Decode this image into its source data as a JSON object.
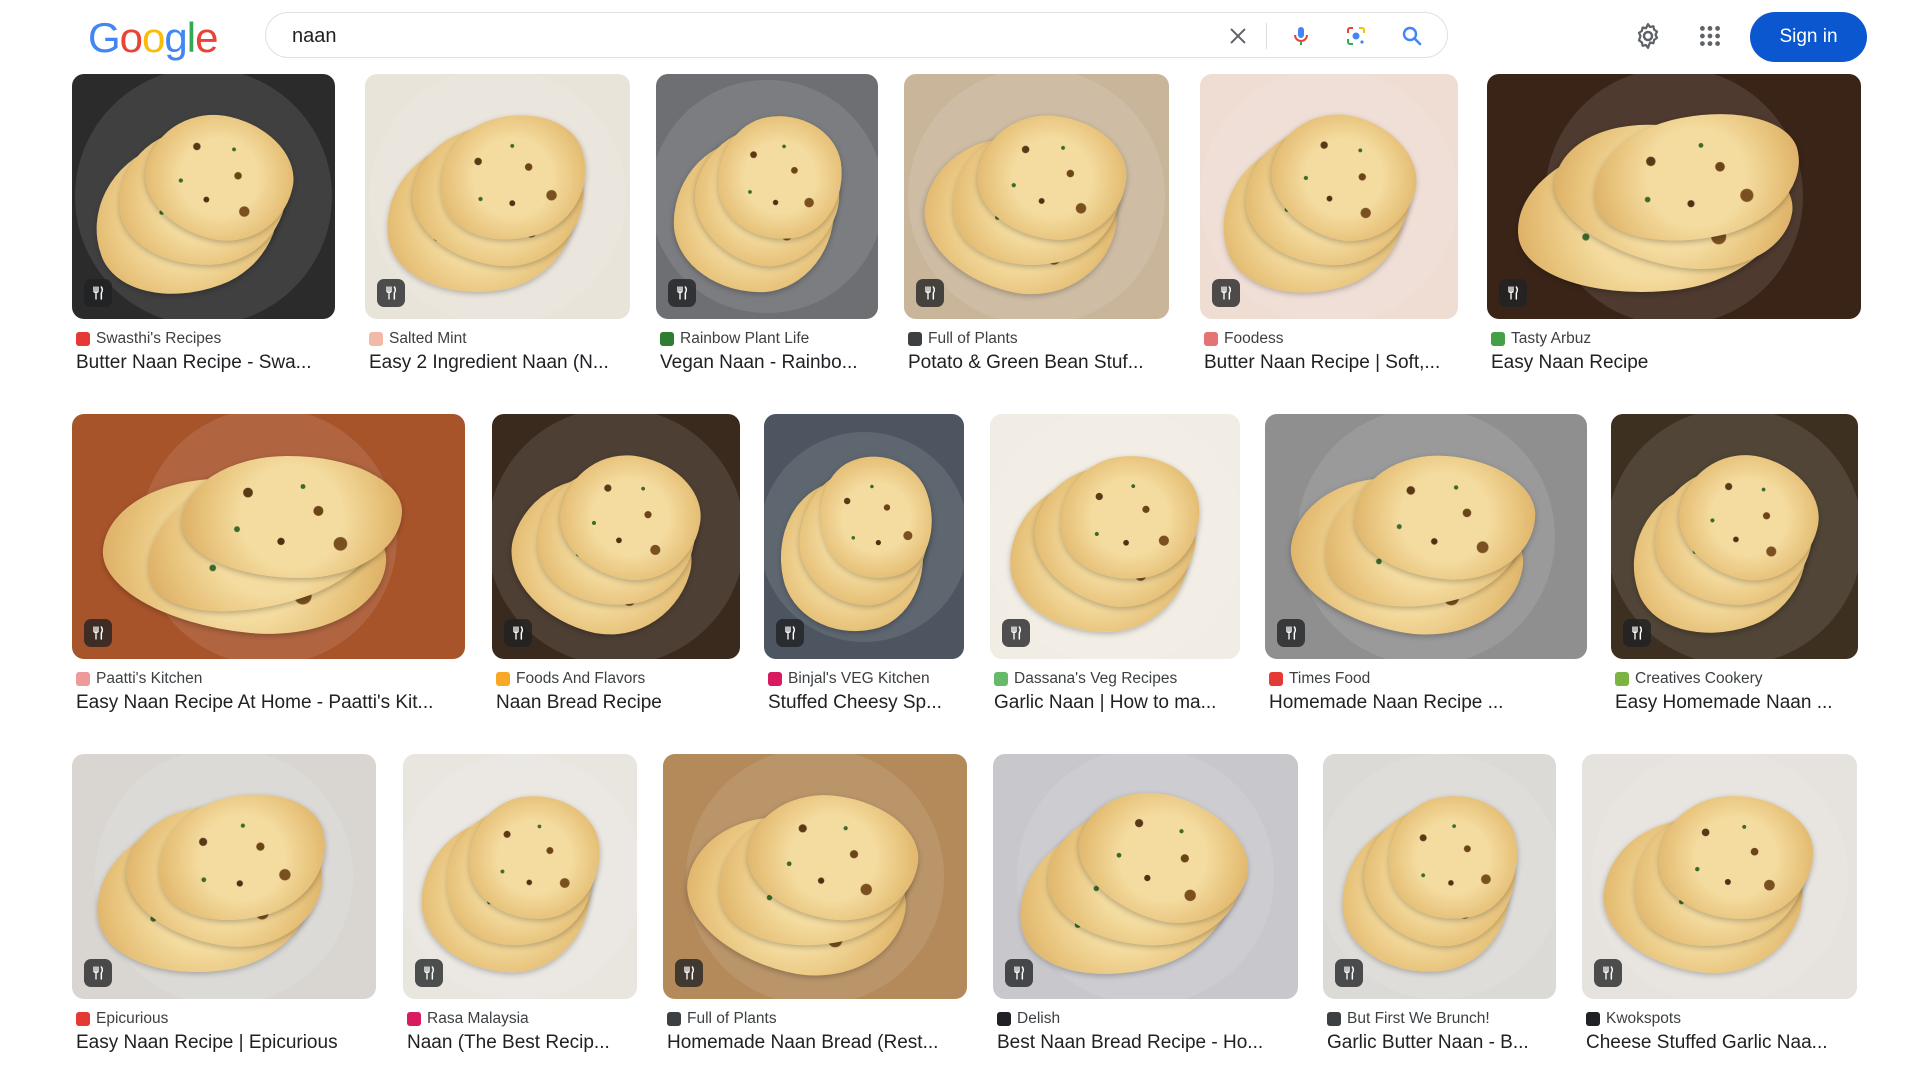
{
  "logo": {
    "letters": [
      "G",
      "o",
      "o",
      "g",
      "l",
      "e"
    ],
    "colors": [
      "#4285F4",
      "#EA4335",
      "#FBBC05",
      "#4285F4",
      "#34A853",
      "#EA4335"
    ]
  },
  "search": {
    "value": "naan",
    "clear_icon": "close-icon",
    "voice_icon": "microphone-icon",
    "lens_icon": "lens-icon",
    "search_icon": "search-icon"
  },
  "header": {
    "settings_icon": "gear-icon",
    "apps_icon": "apps-grid-icon",
    "sign_in_label": "Sign in",
    "accent": "#0b57d0"
  },
  "results": [
    {
      "source": "Swasthi's Recipes",
      "title": "Butter Naan Recipe - Swa...",
      "fav": "#e53935",
      "bg": "#2b2b2b"
    },
    {
      "source": "Salted Mint",
      "title": "Easy 2 Ingredient Naan (N...",
      "fav": "#f2b8a8",
      "bg": "#e9e4da"
    },
    {
      "source": "Rainbow Plant Life",
      "title": "Vegan Naan - Rainbo...",
      "fav": "#2e7d32",
      "bg": "#6d6f73"
    },
    {
      "source": "Full of Plants",
      "title": "Potato & Green Bean Stuf...",
      "fav": "#3c4043",
      "bg": "#c9b59a"
    },
    {
      "source": "Foodess",
      "title": "Butter Naan Recipe | Soft,...",
      "fav": "#e57373",
      "bg": "#efdcd2"
    },
    {
      "source": "Tasty Arbuz",
      "title": "Easy Naan Recipe",
      "fav": "#43a047",
      "bg": "#3a2418"
    },
    {
      "source": "Paatti's Kitchen",
      "title": "Easy Naan Recipe At Home - Paatti's Kit...",
      "fav": "#ef9a9a",
      "bg": "#a8542b"
    },
    {
      "source": "Foods And Flavors",
      "title": "Naan Bread Recipe",
      "fav": "#f9a825",
      "bg": "#3a2a1e"
    },
    {
      "source": "Binjal's VEG Kitchen",
      "title": "Stuffed Cheesy Sp...",
      "fav": "#d81b60",
      "bg": "#4c5560"
    },
    {
      "source": "Dassana's Veg Recipes",
      "title": "Garlic Naan | How to ma...",
      "fav": "#66bb6a",
      "bg": "#f1ece4"
    },
    {
      "source": "Times Food",
      "title": "Homemade Naan Recipe ...",
      "fav": "#e53935",
      "bg": "#8f8f8f"
    },
    {
      "source": "Creatives Cookery",
      "title": "Easy Homemade Naan ...",
      "fav": "#7cb342",
      "bg": "#3d3020"
    },
    {
      "source": "Epicurious",
      "title": "Easy Naan Recipe | Epicurious",
      "fav": "#e53935",
      "bg": "#d9d6d2"
    },
    {
      "source": "Rasa Malaysia",
      "title": "Naan (The Best Recip...",
      "fav": "#d81b60",
      "bg": "#e9e6e0"
    },
    {
      "source": "Full of Plants",
      "title": "Homemade Naan Bread (Rest...",
      "fav": "#3c4043",
      "bg": "#b48a5a"
    },
    {
      "source": "Delish",
      "title": "Best Naan Bread Recipe - Ho...",
      "fav": "#202124",
      "bg": "#c8c8cc"
    },
    {
      "source": "But First We Brunch!",
      "title": "Garlic Butter Naan - B...",
      "fav": "#3c4043",
      "bg": "#dcdad6"
    },
    {
      "source": "Kwokspots",
      "title": "Cheese Stuffed Garlic Naa...",
      "fav": "#202124",
      "bg": "#e6e3de"
    }
  ],
  "thumb_badge_icon": "recipe-utensils-icon"
}
